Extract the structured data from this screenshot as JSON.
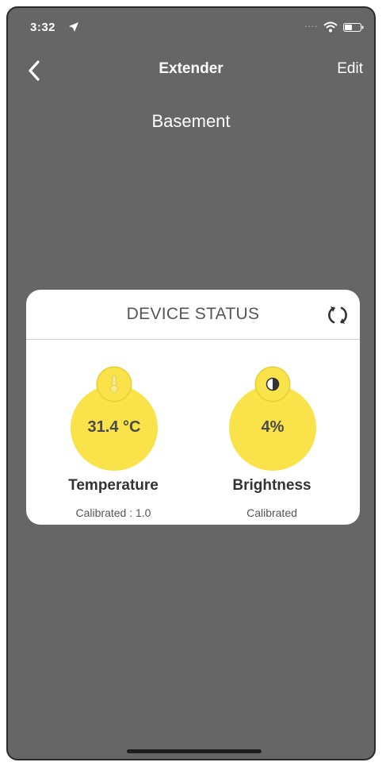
{
  "status_bar": {
    "time": "3:32",
    "signal": "....",
    "location_icon": "location-arrow-icon",
    "wifi_icon": "wifi-icon",
    "battery_icon": "battery-icon"
  },
  "nav": {
    "back_icon": "chevron-left-icon",
    "title": "Extender",
    "edit_label": "Edit"
  },
  "room": {
    "name": "Basement"
  },
  "device_status": {
    "title": "DEVICE STATUS",
    "refresh_icon": "refresh-icon",
    "sensors": [
      {
        "value": "31.4 °C",
        "label": "Temperature",
        "caption": "Calibrated : 1.0",
        "icon": "thermometer-icon"
      },
      {
        "value": "4%",
        "label": "Brightness",
        "caption": "Calibrated",
        "icon": "brightness-icon"
      }
    ]
  },
  "colors": {
    "background": "#666666",
    "card": "#ffffff",
    "sensor_accent": "#f9e24a",
    "text_dark": "#333333",
    "text_light": "#ffffff"
  }
}
